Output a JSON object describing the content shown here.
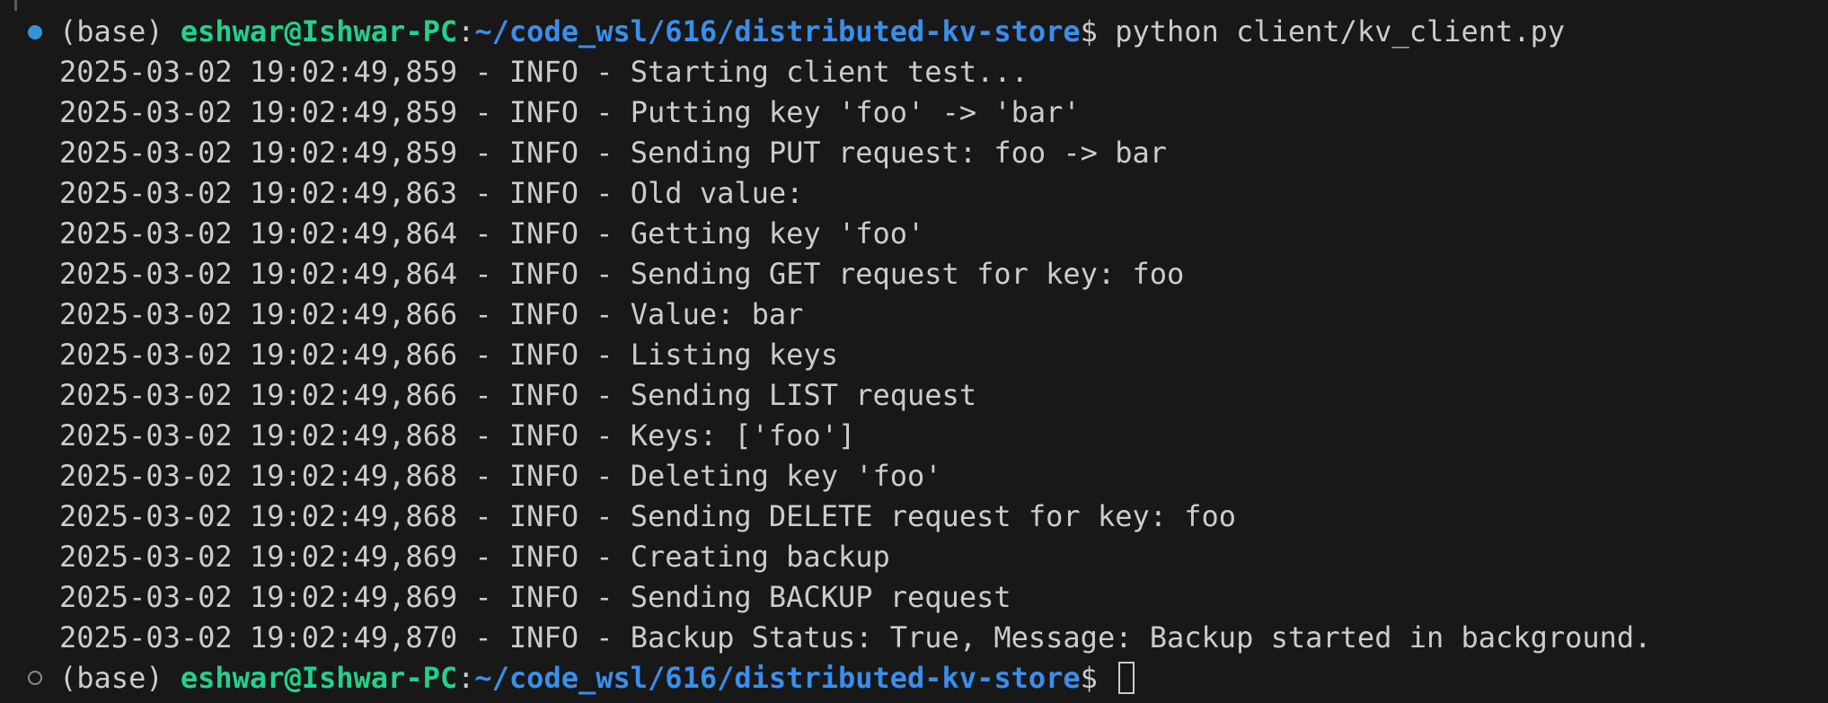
{
  "prompt_first": {
    "env": "(base)",
    "user_host": "eshwar@Ishwar-PC",
    "sep": ":",
    "path": "~/code_wsl/616/distributed-kv-store",
    "symbol": "$",
    "command": "python client/kv_client.py"
  },
  "log_lines": [
    "2025-03-02 19:02:49,859 - INFO - Starting client test...",
    "2025-03-02 19:02:49,859 - INFO - Putting key 'foo' -> 'bar'",
    "2025-03-02 19:02:49,859 - INFO - Sending PUT request: foo -> bar",
    "2025-03-02 19:02:49,863 - INFO - Old value:",
    "2025-03-02 19:02:49,864 - INFO - Getting key 'foo'",
    "2025-03-02 19:02:49,864 - INFO - Sending GET request for key: foo",
    "2025-03-02 19:02:49,866 - INFO - Value: bar",
    "2025-03-02 19:02:49,866 - INFO - Listing keys",
    "2025-03-02 19:02:49,866 - INFO - Sending LIST request",
    "2025-03-02 19:02:49,868 - INFO - Keys: ['foo']",
    "2025-03-02 19:02:49,868 - INFO - Deleting key 'foo'",
    "2025-03-02 19:02:49,868 - INFO - Sending DELETE request for key: foo",
    "2025-03-02 19:02:49,869 - INFO - Creating backup",
    "2025-03-02 19:02:49,869 - INFO - Sending BACKUP request",
    "2025-03-02 19:02:49,870 - INFO - Backup Status: True, Message: Backup started in background."
  ],
  "prompt_last": {
    "env": "(base)",
    "user_host": "eshwar@Ishwar-PC",
    "sep": ":",
    "path": "~/code_wsl/616/distributed-kv-store",
    "symbol": "$"
  },
  "colors": {
    "background": "#181818",
    "text": "#cccccc",
    "user_host": "#23d18b",
    "path": "#3b8eea",
    "status_dot_success": "#3794d3"
  }
}
